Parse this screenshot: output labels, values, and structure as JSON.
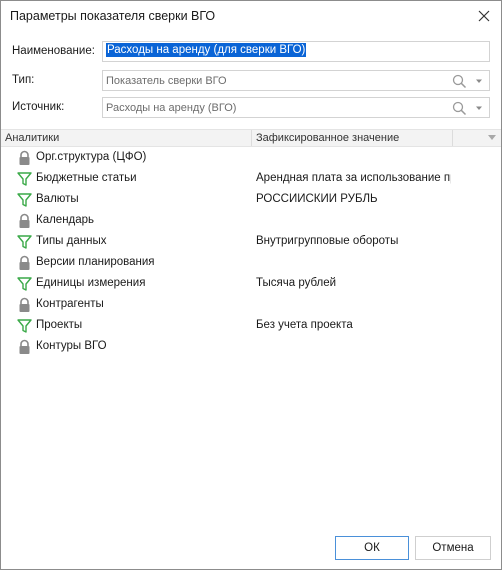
{
  "dialog": {
    "title": "Параметры показателя сверки ВГО"
  },
  "form": {
    "name_label": "Наименование:",
    "name_value": "Расходы на аренду (для сверки ВГО)",
    "type_label": "Тип:",
    "type_value": "Показатель сверки ВГО",
    "source_label": "Источник:",
    "source_value": "Расходы на аренду (ВГО)"
  },
  "grid": {
    "columns": [
      "Аналитики",
      "Зафиксированное значение"
    ],
    "rows": [
      {
        "icon": "lock-icon",
        "name": "Орг.структура (ЦФО)",
        "value": ""
      },
      {
        "icon": "filter-icon",
        "name": "Бюджетные статьи",
        "value": "Арендная плата за использование про"
      },
      {
        "icon": "filter-icon",
        "name": "Валюты",
        "value": "РОССИЙСКИЙ РУБЛЬ"
      },
      {
        "icon": "lock-icon",
        "name": "Календарь",
        "value": ""
      },
      {
        "icon": "filter-icon",
        "name": "Типы данных",
        "value": "Внутригрупповые обороты"
      },
      {
        "icon": "lock-icon",
        "name": "Версии планирования",
        "value": ""
      },
      {
        "icon": "filter-icon",
        "name": "Единицы измерения",
        "value": "Тысяча рублей"
      },
      {
        "icon": "lock-icon",
        "name": "Контрагенты",
        "value": ""
      },
      {
        "icon": "filter-icon",
        "name": "Проекты",
        "value": "Без учета проекта"
      },
      {
        "icon": "lock-icon",
        "name": "Контуры ВГО",
        "value": ""
      }
    ]
  },
  "buttons": {
    "ok": "ОК",
    "cancel": "Отмена"
  },
  "colors": {
    "selection": "#0a64d6",
    "filter_icon": "#3aa948",
    "lock_icon": "#8a8a8a",
    "ok_border": "#4a90d9"
  }
}
